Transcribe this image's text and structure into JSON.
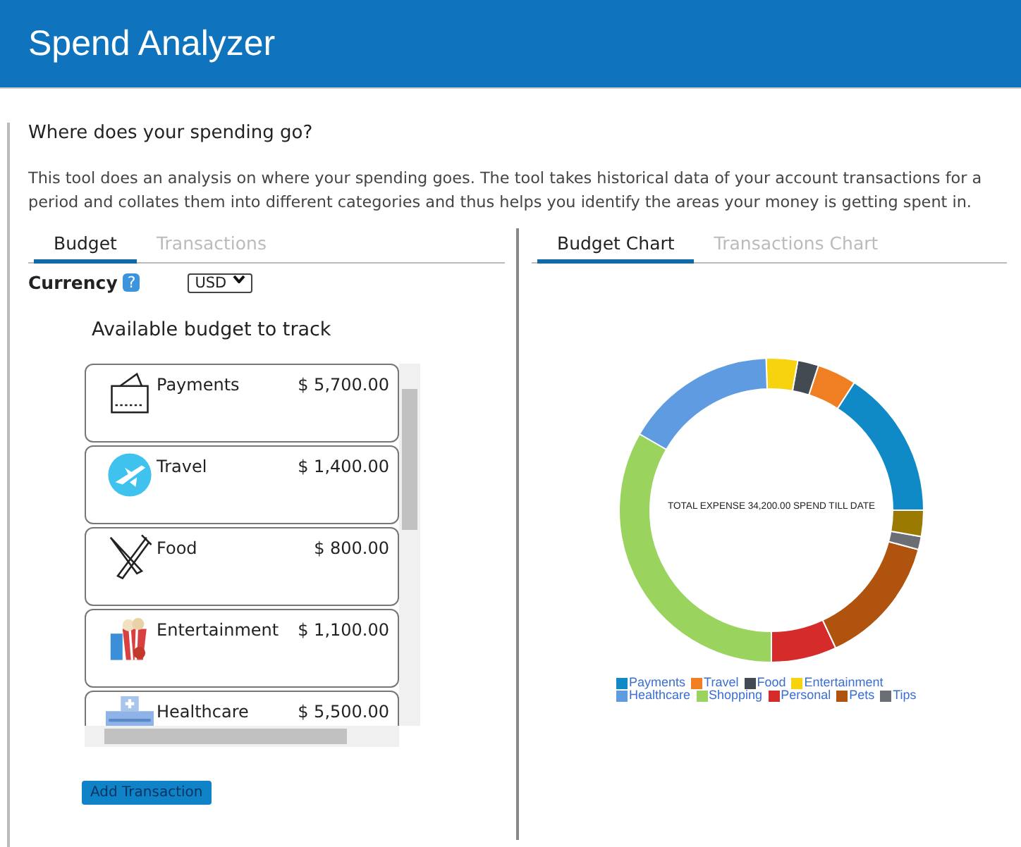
{
  "header": {
    "title": "Spend Analyzer"
  },
  "question": "Where does your spending go?",
  "description": "This tool does an analysis on where your spending goes. The tool takes historical data of your account transactions for a period and collates them into different categories and thus helps you identify the areas your money is getting spent in.",
  "left_tabs": [
    {
      "label": "Budget",
      "selected": true
    },
    {
      "label": "Transactions",
      "selected": false
    }
  ],
  "currency": {
    "label": "Currency",
    "help": "?",
    "value": "USD"
  },
  "budget_title": "Available budget to track",
  "budget_items": [
    {
      "kind": "wallet",
      "name": "Payments",
      "amount": "$ 5,700.00"
    },
    {
      "kind": "plane",
      "name": "Travel",
      "amount": "$ 1,400.00"
    },
    {
      "kind": "cutlery",
      "name": "Food",
      "amount": "$ 800.00"
    },
    {
      "kind": "popcorn",
      "name": "Entertainment",
      "amount": "$ 1,100.00"
    },
    {
      "kind": "building",
      "name": "Healthcare",
      "amount": "$ 5,500.00"
    }
  ],
  "add_button": "Add Transaction",
  "right_tabs": [
    {
      "label": "Budget Chart",
      "selected": true
    },
    {
      "label": "Transactions Chart",
      "selected": false
    }
  ],
  "chart": {
    "center_text": "TOTAL EXPENSE 34,200.00 SPEND TILL DATE",
    "legend": [
      {
        "label": "Payments",
        "color": "#0f8ac7"
      },
      {
        "label": "Travel",
        "color": "#ef7f22"
      },
      {
        "label": "Food",
        "color": "#444a52"
      },
      {
        "label": "Entertainment",
        "color": "#f7d20f"
      },
      {
        "label": "Healthcare",
        "color": "#5f9be0"
      },
      {
        "label": "Shopping",
        "color": "#9ad45e"
      },
      {
        "label": "Personal",
        "color": "#d62b2b"
      },
      {
        "label": "Pets",
        "color": "#b0530f"
      },
      {
        "label": "Tips",
        "color": "#6b6f75"
      }
    ]
  }
}
